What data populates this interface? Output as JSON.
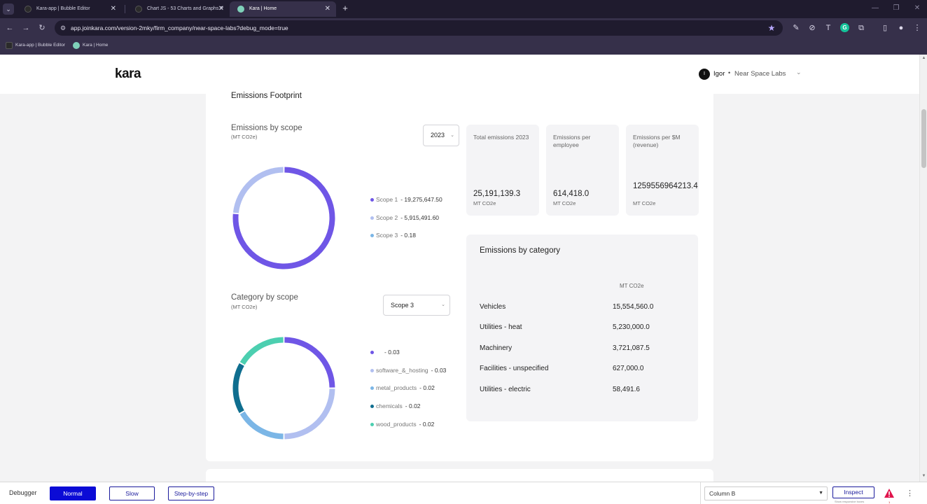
{
  "browser": {
    "tabs": [
      {
        "title": "Kara-app | Bubble Editor",
        "favicon_color": "#2b2b2b"
      },
      {
        "title": "Chart JS - 53 Charts and Graphs P",
        "favicon_color": "#2b2b2b"
      },
      {
        "title": "Kara | Home",
        "favicon_color": "#7fd1b9"
      }
    ],
    "url": "app.joinkara.com/version-2mky/firm_company/near-space-labs?debug_mode=true",
    "bookmarks": [
      {
        "title": "Kara-app | Bubble Editor",
        "favicon_color": "#2b2b2b"
      },
      {
        "title": "Kara | Home",
        "favicon_color": "#7fd1b9"
      }
    ]
  },
  "header": {
    "logo": "kara",
    "user_initial": "I",
    "user_name": "Igor",
    "separator": "•",
    "company": "Near Space Labs"
  },
  "section": {
    "title": "Emissions Footprint"
  },
  "emissions_by_scope": {
    "title": "Emissions by scope",
    "unit": "(MT CO2e)",
    "year_select": "2023",
    "legend": [
      {
        "label": "Scope 1",
        "value": "- 19,275,647.50",
        "color": "#6f56e6"
      },
      {
        "label": "Scope 2",
        "value": "- 5,915,491.60",
        "color": "#b1bff0"
      },
      {
        "label": "Scope 3",
        "value": "- 0.18",
        "color": "#7bb6e6"
      }
    ]
  },
  "stats": [
    {
      "title": "Total emissions 2023",
      "value": "25,191,139.3",
      "unit": "MT CO2e"
    },
    {
      "title": "Emissions per employee",
      "value": "614,418.0",
      "unit": "MT CO2e"
    },
    {
      "title": "Emissions per $M (revenue)",
      "value": "1259556964213.4",
      "unit": "MT CO2e"
    }
  ],
  "category_by_scope": {
    "title": "Category by scope",
    "unit": "(MT CO2e)",
    "scope_select": "Scope 3",
    "legend": [
      {
        "label": "",
        "value": "- 0.03",
        "color": "#6f56e6"
      },
      {
        "label": "software_&_hosting",
        "value": "- 0.03",
        "color": "#b1bff0"
      },
      {
        "label": "metal_products",
        "value": "- 0.02",
        "color": "#7bb6e6"
      },
      {
        "label": "chemicals",
        "value": "- 0.02",
        "color": "#0f6e8f"
      },
      {
        "label": "wood_products",
        "value": "- 0.02",
        "color": "#4ccfb0"
      }
    ]
  },
  "emissions_by_category": {
    "title": "Emissions by category",
    "column_header": "MT CO2e",
    "rows": [
      {
        "name": "Vehicles",
        "value": "15,554,560.0"
      },
      {
        "name": "Utilities - heat",
        "value": "5,230,000.0"
      },
      {
        "name": "Machinery",
        "value": "3,721,087.5"
      },
      {
        "name": "Facilities - unspecified",
        "value": "627,000.0"
      },
      {
        "name": "Utilities - electric",
        "value": "58,491.6"
      }
    ]
  },
  "chart_data": [
    {
      "type": "pie",
      "title": "Emissions by scope",
      "categories": [
        "Scope 1",
        "Scope 2",
        "Scope 3"
      ],
      "values": [
        19275647.5,
        5915491.6,
        0.18
      ],
      "colors": [
        "#6f56e6",
        "#b1bff0",
        "#7bb6e6"
      ]
    },
    {
      "type": "pie",
      "title": "Category by scope",
      "categories": [
        "",
        "software_&_hosting",
        "metal_products",
        "chemicals",
        "wood_products"
      ],
      "values": [
        0.03,
        0.03,
        0.02,
        0.02,
        0.02
      ],
      "colors": [
        "#6f56e6",
        "#b1bff0",
        "#7bb6e6",
        "#0f6e8f",
        "#4ccfb0"
      ]
    }
  ],
  "debugger": {
    "label": "Debugger",
    "modes": [
      "Normal",
      "Slow",
      "Step-by-step"
    ],
    "active_mode": "Normal",
    "element_select": "Column B",
    "inspect": "Inspect",
    "inspect_hint": "Show responsive boxes",
    "warning_count": "1"
  }
}
